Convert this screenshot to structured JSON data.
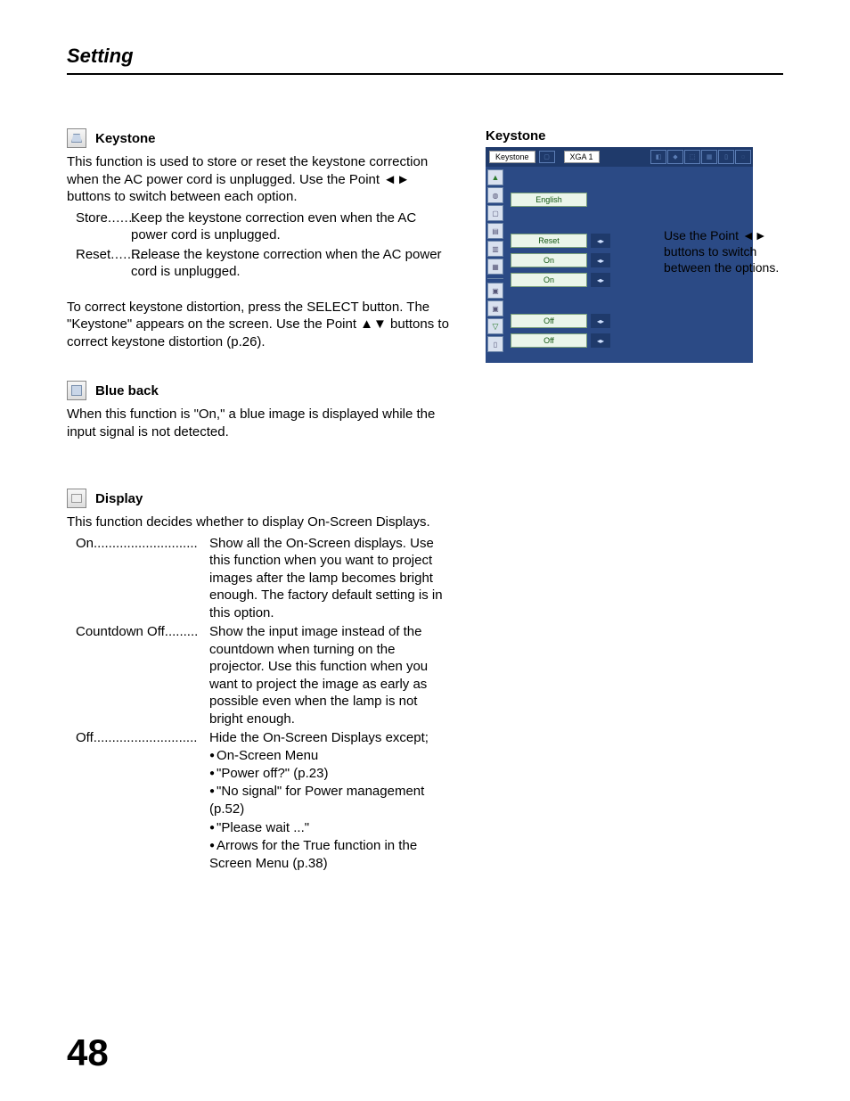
{
  "header": "Setting",
  "page_number": "48",
  "left": {
    "keystone": {
      "title": "Keystone",
      "intro1": "This function is used to store or reset the keystone correction when the AC power cord is unplugged. Use the Point ◄► buttons to switch between each option.",
      "store_term": "Store",
      "store_def": "Keep the keystone correction even when the AC power cord is unplugged.",
      "reset_term": "Reset",
      "reset_def": "Release the keystone correction when the AC power cord is unplugged.",
      "intro2": "To correct keystone distortion, press the SELECT button. The \"Keystone\" appears on the screen. Use the Point ▲▼ buttons to correct keystone distortion (p.26)."
    },
    "blueback": {
      "title": "Blue back",
      "body": "When this function is \"On,\" a blue image is displayed while the input signal is not detected."
    },
    "display": {
      "title": "Display",
      "intro": "This function decides whether to display On-Screen Displays.",
      "on_term": "On",
      "on_def": "Show all the On-Screen displays. Use this function when you want to project images after the lamp becomes bright enough. The factory default setting is in this option.",
      "cd_term": "Countdown Off",
      "cd_def": "Show the input image instead of the countdown when turning on the projector. Use this function when you want to project the image as early as possible even when the lamp is not bright enough.",
      "off_term": "Off",
      "off_def_lead": "Hide the On-Screen Displays except;",
      "off_items": [
        "On-Screen Menu",
        "\"Power off?\" (p.23)",
        "\"No signal\" for Power management (p.52)",
        "\"Please wait ...\"",
        "Arrows for the True function in the Screen Menu (p.38)"
      ]
    }
  },
  "right": {
    "title": "Keystone",
    "topbar_label": "Keystone",
    "topbar_mode": "XGA 1",
    "rows": {
      "language": "English",
      "keystone": "Reset",
      "blueback": "On",
      "display": "On",
      "logo": "Off",
      "ceiling": "Off"
    },
    "caption": "Use the Point ◄► buttons to switch between the options."
  }
}
